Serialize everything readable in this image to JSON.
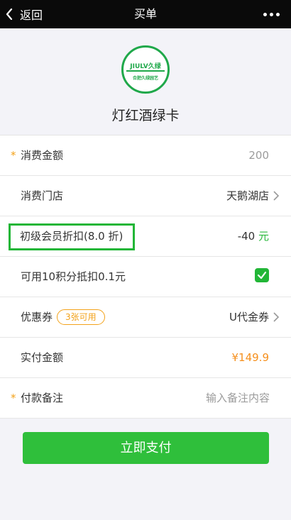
{
  "header": {
    "back_label": "返回",
    "title": "买单"
  },
  "shop": {
    "logo_main": "JIULV久绿",
    "logo_sub": "合肥久绿园艺",
    "name": "灯红酒绿卡"
  },
  "form": {
    "amount_label": "消费金额",
    "amount_value": "200",
    "store_label": "消费门店",
    "store_value": "天鹅湖店",
    "discount_label": "初级会员折扣(8.0 折)",
    "discount_amount": "-40",
    "discount_unit": "元",
    "points_label": "可用10积分抵扣0.1元",
    "points_checked": true,
    "coupon_label": "优惠券",
    "coupon_badge": "3张可用",
    "coupon_value": "U代金券",
    "actual_label": "实付金额",
    "actual_value": "¥149.9",
    "note_label": "付款备注",
    "note_placeholder": "输入备注内容",
    "required_mark": "*"
  },
  "pay_button_label": "立即支付",
  "colors": {
    "accent_green": "#2fbf3b",
    "highlight_orange": "#f5901e",
    "required_star": "#f3a21a",
    "topbar": "#0a0a0a"
  }
}
